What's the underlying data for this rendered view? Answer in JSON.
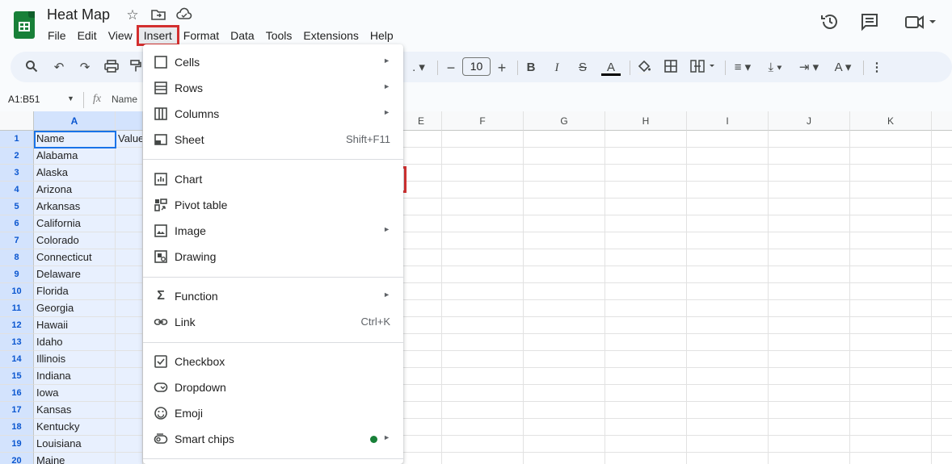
{
  "document": {
    "title": "Heat Map"
  },
  "menu": [
    "File",
    "Edit",
    "View",
    "Insert",
    "Format",
    "Data",
    "Tools",
    "Extensions",
    "Help"
  ],
  "toolbar": {
    "font_size": "10",
    "ellipsis": "."
  },
  "formula_bar": {
    "name_box": "A1:B51",
    "content": "Name"
  },
  "columns": [
    "A",
    "",
    "E",
    "F",
    "G",
    "H",
    "I",
    "J",
    "K"
  ],
  "rows": [
    {
      "num": "1",
      "a": "Name",
      "b": "Value"
    },
    {
      "num": "2",
      "a": "Alabama",
      "b": ""
    },
    {
      "num": "3",
      "a": "Alaska",
      "b": ""
    },
    {
      "num": "4",
      "a": "Arizona",
      "b": ""
    },
    {
      "num": "5",
      "a": "Arkansas",
      "b": ""
    },
    {
      "num": "6",
      "a": "California",
      "b": ""
    },
    {
      "num": "7",
      "a": "Colorado",
      "b": ""
    },
    {
      "num": "8",
      "a": "Connecticut",
      "b": ""
    },
    {
      "num": "9",
      "a": "Delaware",
      "b": ""
    },
    {
      "num": "10",
      "a": "Florida",
      "b": ""
    },
    {
      "num": "11",
      "a": "Georgia",
      "b": ""
    },
    {
      "num": "12",
      "a": "Hawaii",
      "b": ""
    },
    {
      "num": "13",
      "a": "Idaho",
      "b": ""
    },
    {
      "num": "14",
      "a": "Illinois",
      "b": ""
    },
    {
      "num": "15",
      "a": "Indiana",
      "b": ""
    },
    {
      "num": "16",
      "a": "Iowa",
      "b": ""
    },
    {
      "num": "17",
      "a": "Kansas",
      "b": ""
    },
    {
      "num": "18",
      "a": "Kentucky",
      "b": ""
    },
    {
      "num": "19",
      "a": "Louisiana",
      "b": ""
    },
    {
      "num": "20",
      "a": "Maine",
      "b": ""
    }
  ],
  "insert_menu": {
    "cells": "Cells",
    "rows": "Rows",
    "columns": "Columns",
    "sheet": "Sheet",
    "sheet_shortcut": "Shift+F11",
    "chart": "Chart",
    "pivot_table": "Pivot table",
    "image": "Image",
    "drawing": "Drawing",
    "function": "Function",
    "link": "Link",
    "link_shortcut": "Ctrl+K",
    "checkbox": "Checkbox",
    "dropdown": "Dropdown",
    "emoji": "Emoji",
    "smart_chips": "Smart chips"
  },
  "colors": {
    "highlight": "#d32f2f",
    "brand": "#188038",
    "selection": "#d3e3fd"
  }
}
